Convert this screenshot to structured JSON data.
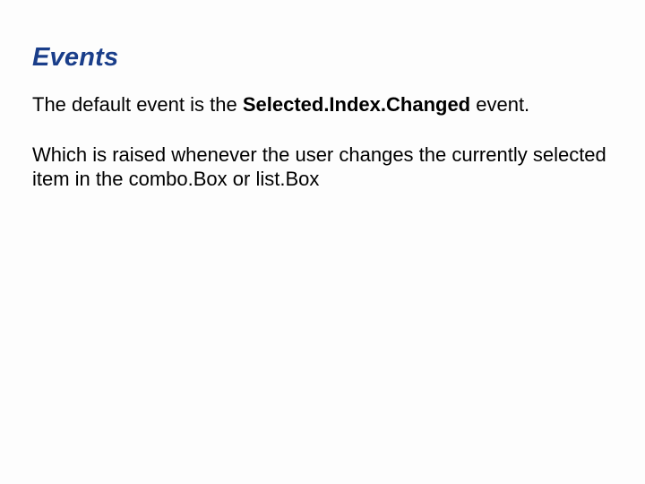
{
  "slide": {
    "title": "Events",
    "para1_pre": "The default event is the ",
    "para1_bold": "Selected.Index.Changed",
    "para1_post": " event.",
    "para2": "Which is raised whenever the user changes the currently selected item in the combo.Box or list.Box"
  }
}
